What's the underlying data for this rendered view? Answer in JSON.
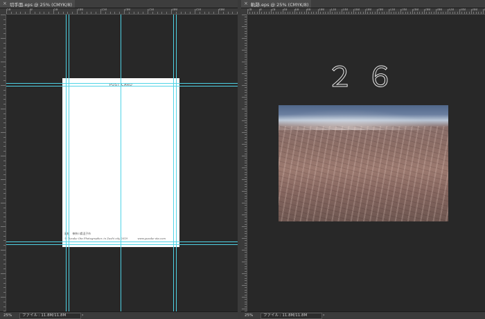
{
  "left_window": {
    "tab_title": "切手面.eps @ 25% (CMYK/8)",
    "zoom": "25%",
    "file_info": "ファイル : 11.8M/11.8M",
    "ruler_numbers": [
      "50",
      "0",
      "50",
      "100",
      "150",
      "200",
      "250",
      "300",
      "350",
      "400",
      "450"
    ],
    "postcard": {
      "title": "POST CARD",
      "line1": "風紋　神奈川県逗子市",
      "line2": "© Yusuke Ota Photographer, in Zushi city 2019",
      "url": "www.yusuke-ota.com"
    }
  },
  "right_window": {
    "tab_title": "軌跡.eps @ 25% (CMYK/8)",
    "zoom": "25%",
    "file_info": "ファイル : 11.8M/11.8M",
    "ruler_numbers": [
      "20",
      "0",
      "20",
      "40",
      "60",
      "80",
      "100",
      "120",
      "140",
      "160",
      "180",
      "200",
      "220",
      "240",
      "260",
      "280",
      "300",
      "320",
      "340",
      "360",
      "380"
    ],
    "page_number": "２６"
  },
  "colors": {
    "guide": "#4fd3e6",
    "canvas_bg": "#282828"
  },
  "icons": {
    "close": "close-icon",
    "status_arrow": "chevron-right-icon"
  }
}
